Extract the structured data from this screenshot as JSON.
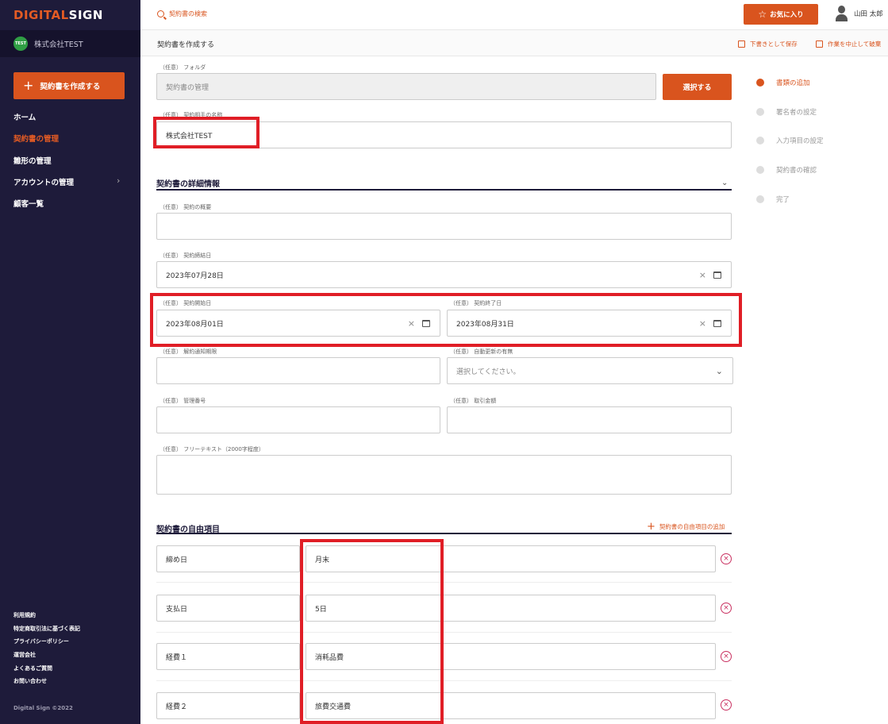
{
  "app": {
    "logo_part1": "DIGITAL",
    "logo_part2": "SIGN",
    "company_avatar": "TEST",
    "company_name": "株式会社TEST"
  },
  "sidebar": {
    "create_button": "契約書を作成する",
    "items": [
      {
        "label": "ホーム"
      },
      {
        "label": "契約書の管理",
        "active": true
      },
      {
        "label": "雛形の管理"
      },
      {
        "label": "アカウントの管理",
        "has_submenu": true
      },
      {
        "label": "顧客一覧"
      }
    ],
    "footer_links": [
      "利用規約",
      "特定商取引法に基づく表記",
      "プライバシーポリシー",
      "運営会社",
      "よくあるご質問",
      "お問い合わせ"
    ],
    "copyright": "Digital Sign ©2022"
  },
  "header": {
    "search_placeholder": "契約書の検索",
    "favorites_button": "お気に入り",
    "user_name": "山田 太郎"
  },
  "subheader": {
    "title": "契約書を作成する",
    "save_draft": "下書きとして保存",
    "cancel": "作業を中止して破棄"
  },
  "form": {
    "folder": {
      "label": "（任意） フォルダ",
      "value": "契約書の管理",
      "button": "選択する"
    },
    "counterparty": {
      "label": "（任意） 契約相手の名称",
      "value": "株式会社TEST"
    },
    "details_title": "契約書の詳細情報",
    "summary": {
      "label": "（任意） 契約の概要",
      "value": ""
    },
    "signing_date": {
      "label": "（任意） 契約締結日",
      "value": "2023年07月28日"
    },
    "start_date": {
      "label": "（任意） 契約開始日",
      "value": "2023年08月01日"
    },
    "end_date": {
      "label": "（任意） 契約終了日",
      "value": "2023年08月31日"
    },
    "notice_period": {
      "label": "（任意） 解約通知期限",
      "value": ""
    },
    "auto_renew": {
      "label": "（任意） 自動更新の有無",
      "placeholder": "選択してください。"
    },
    "management_no": {
      "label": "（任意） 管理番号",
      "value": ""
    },
    "amount": {
      "label": "（任意） 取引金額",
      "value": ""
    },
    "free_text": {
      "label": "（任意） フリーテキスト（2000字程度）",
      "value": ""
    },
    "free_items_title": "契約書の自由項目",
    "free_items_add": "契約書の自由項目の追加",
    "free_items": [
      {
        "key": "締め日",
        "value": "月末"
      },
      {
        "key": "支払日",
        "value": "5日"
      },
      {
        "key": "経費１",
        "value": "消耗品費"
      },
      {
        "key": "経費２",
        "value": "旅費交通費"
      }
    ]
  },
  "steps": [
    {
      "label": "書類の追加",
      "active": true
    },
    {
      "label": "署名者の設定"
    },
    {
      "label": "入力項目の設定"
    },
    {
      "label": "契約書の確認"
    },
    {
      "label": "完了"
    }
  ],
  "icons": {
    "search": "search-icon",
    "star": "star-icon",
    "user": "user-icon",
    "calendar": "calendar-icon",
    "clear": "clear-icon",
    "remove": "remove-circle-icon"
  },
  "colors": {
    "accent": "#d9541e",
    "sidebar": "#1e1b3a",
    "annotation": "#e01e26"
  }
}
